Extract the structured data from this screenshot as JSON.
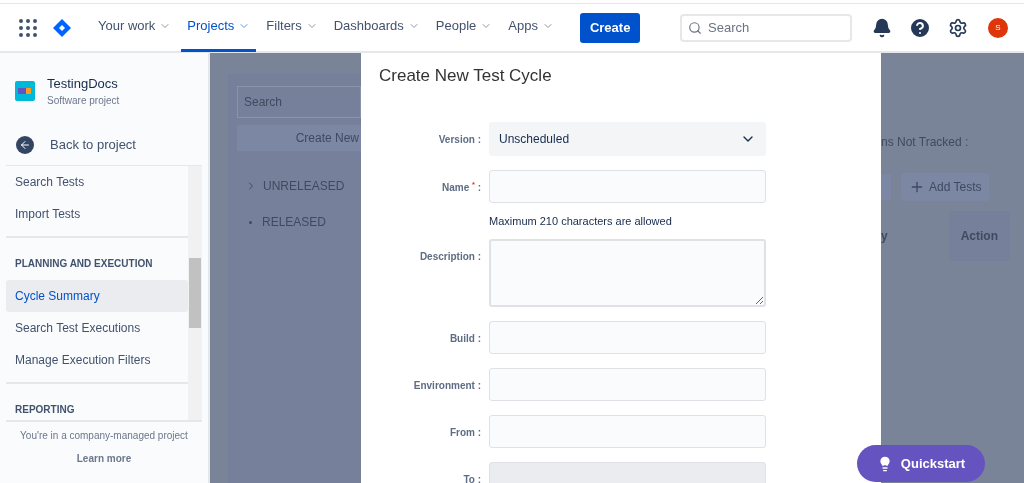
{
  "topnav": {
    "items": [
      {
        "label": "Your work",
        "selected": false
      },
      {
        "label": "Projects",
        "selected": true
      },
      {
        "label": "Filters",
        "selected": false
      },
      {
        "label": "Dashboards",
        "selected": false
      },
      {
        "label": "People",
        "selected": false
      },
      {
        "label": "Apps",
        "selected": false
      }
    ],
    "create_button": "Create",
    "search": {
      "placeholder": "Search"
    },
    "avatar": "S"
  },
  "sidebar": {
    "project": {
      "name": "TestingDocs",
      "type": "Software project"
    },
    "back_link": "Back to project",
    "items": [
      {
        "kind": "link",
        "label": "Search Tests",
        "selected": false
      },
      {
        "kind": "link",
        "label": "Import Tests",
        "selected": false
      },
      {
        "kind": "section",
        "label": "PLANNING AND EXECUTION"
      },
      {
        "kind": "link",
        "label": "Cycle Summary",
        "selected": true
      },
      {
        "kind": "link",
        "label": "Search Test Executions",
        "selected": false
      },
      {
        "kind": "link",
        "label": "Manage Execution Filters",
        "selected": false
      },
      {
        "kind": "section",
        "label": "REPORTING"
      }
    ],
    "footer": "You're in a company-managed project",
    "learn_more": "Learn more"
  },
  "background": {
    "search": {
      "placeholder": "Search"
    },
    "create_button": "Create New",
    "tree": [
      {
        "kind": "folder",
        "label": "UNRELEASED"
      },
      {
        "kind": "leaf",
        "label": "RELEASED"
      }
    ],
    "tracked_label": "ns Not Tracked :",
    "add_button": "Add Tests",
    "columns": [
      "y",
      "Action"
    ]
  },
  "modal": {
    "title": "Create New Test Cycle",
    "fields": [
      {
        "kind": "select",
        "label": "Version :",
        "value": "Unscheduled"
      },
      {
        "kind": "text",
        "label": "Name $^{*}$ :",
        "hint": "Maximum 210 characters are allowed",
        "disabled": false
      },
      {
        "kind": "textarea",
        "label": "Description :",
        "disabled": false
      },
      {
        "kind": "text",
        "label": "Build :",
        "disabled": false
      },
      {
        "kind": "text",
        "label": "Environment :",
        "disabled": false
      },
      {
        "kind": "text",
        "label": "From :",
        "disabled": false
      },
      {
        "kind": "text",
        "label": "To :",
        "disabled": true
      }
    ]
  },
  "quickstart": "Quickstart"
}
